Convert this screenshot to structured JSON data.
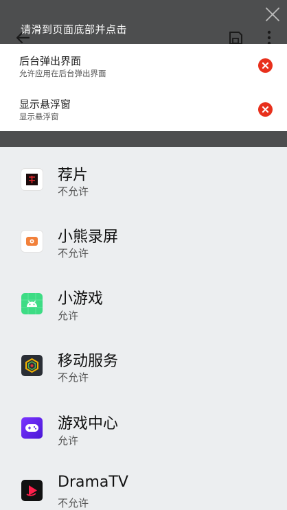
{
  "overlay": {
    "hint_text": "请滑到页面底部并点击"
  },
  "toolbar": {
    "icons": [
      "back-arrow-icon",
      "save-icon",
      "more-vertical-icon",
      "close-icon"
    ]
  },
  "permission_panel": {
    "items": [
      {
        "title": "后台弹出界面",
        "subtitle": "允许应用在后台弹出界面",
        "icon": "remove-circle-icon",
        "accent": "#e8301c"
      },
      {
        "title": "显示悬浮窗",
        "subtitle": "显示悬浮窗",
        "icon": "remove-circle-icon",
        "accent": "#e8301c"
      }
    ]
  },
  "apps": [
    {
      "name": "荐片",
      "status": "不允许",
      "icon": "jianpian-app-icon"
    },
    {
      "name": "小熊录屏",
      "status": "不允许",
      "icon": "bear-recorder-app-icon"
    },
    {
      "name": "小游戏",
      "status": "允许",
      "icon": "android-mini-game-icon"
    },
    {
      "name": "移动服务",
      "status": "不允许",
      "icon": "mobile-services-app-icon"
    },
    {
      "name": "游戏中心",
      "status": "允许",
      "icon": "game-center-app-icon"
    },
    {
      "name": "DramaTV",
      "status": "不允许",
      "icon": "dramatv-app-icon"
    }
  ],
  "colors": {
    "overlay_dark": "#4d4e4f",
    "list_background": "#eceef0",
    "remove_red": "#e8301c"
  }
}
